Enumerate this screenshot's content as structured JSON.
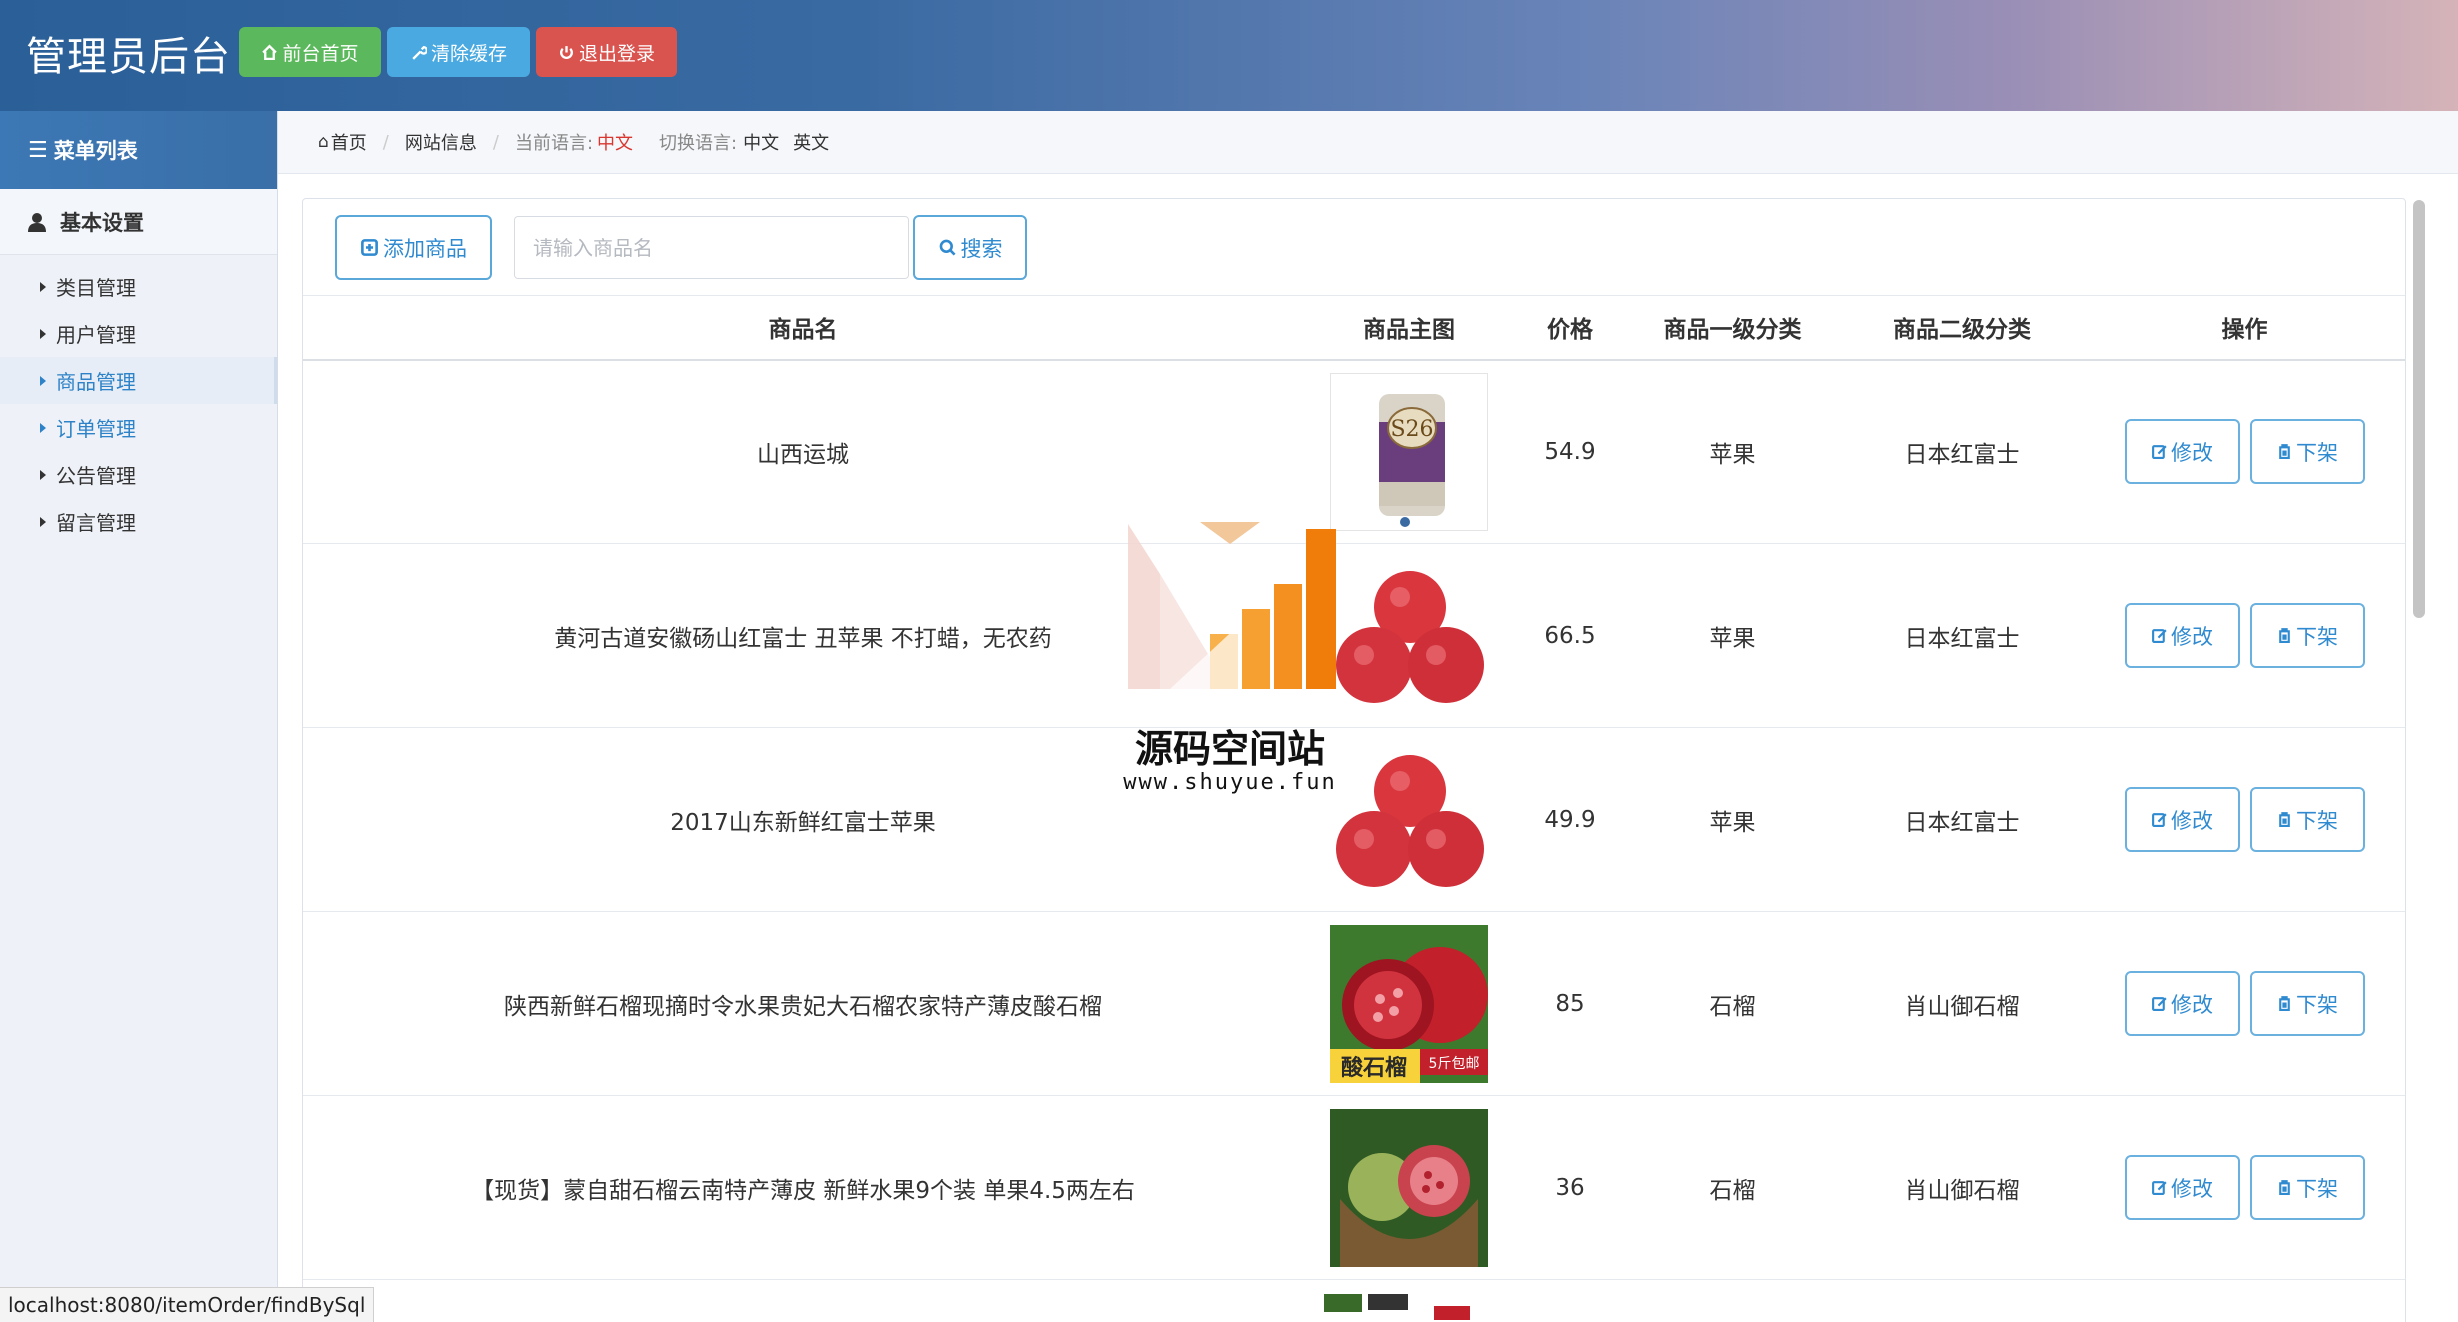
{
  "header": {
    "brand": "管理员后台",
    "buttons": [
      {
        "label": "前台首页",
        "icon": "home-icon",
        "color": "#5cb85c"
      },
      {
        "label": "清除缓存",
        "icon": "wrench-icon",
        "color": "#4aa9e0"
      },
      {
        "label": "退出登录",
        "icon": "power-icon",
        "color": "#d9534f"
      }
    ]
  },
  "sidebar": {
    "title": "菜单列表",
    "group": "基本设置",
    "items": [
      {
        "label": "类目管理",
        "active": false
      },
      {
        "label": "用户管理",
        "active": false
      },
      {
        "label": "商品管理",
        "active": true
      },
      {
        "label": "订单管理",
        "active": false
      },
      {
        "label": "公告管理",
        "active": false
      },
      {
        "label": "留言管理",
        "active": false
      }
    ]
  },
  "breadcrumb": {
    "home": "首页",
    "site_info": "网站信息",
    "current_lang_label": "当前语言:",
    "current_lang": "中文",
    "switch_label": "切换语言:",
    "lang_cn": "中文",
    "lang_en": "英文"
  },
  "toolbar": {
    "add_label": "添加商品",
    "search_placeholder": "请输入商品名",
    "search_label": "搜索"
  },
  "table": {
    "headers": [
      "商品名",
      "商品主图",
      "价格",
      "商品一级分类",
      "商品二级分类",
      "操作"
    ],
    "rows": [
      {
        "name": "山西运城",
        "image": "formula-can",
        "price": "54.9",
        "cat1": "苹果",
        "cat2": "日本红富士"
      },
      {
        "name": "黄河古道安徽砀山红富士 丑苹果 不打蜡，无农药",
        "image": "red-apples",
        "price": "66.5",
        "cat1": "苹果",
        "cat2": "日本红富士"
      },
      {
        "name": "2017山东新鲜红富士苹果",
        "image": "red-apples",
        "price": "49.9",
        "cat1": "苹果",
        "cat2": "日本红富士"
      },
      {
        "name": "陕西新鲜石榴现摘时令水果贵妃大石榴农家特产薄皮酸石榴",
        "image": "pomegranate-poster",
        "price": "85",
        "cat1": "石榴",
        "cat2": "肖山御石榴"
      },
      {
        "name": "【现货】蒙自甜石榴云南特产薄皮 新鲜水果9个装 单果4.5两左右",
        "image": "pomegranate-basket",
        "price": "36",
        "cat1": "石榴",
        "cat2": "肖山御石榴"
      }
    ],
    "edit_label": "修改",
    "offshelf_label": "下架",
    "image_texts": {
      "formula_can": "S26",
      "poster_main": "酸石榴",
      "poster_badge": "5斤包邮"
    }
  },
  "watermark": {
    "title": "源码空间站",
    "url": "www.shuyue.fun"
  },
  "statusbar": {
    "url": "localhost:8080/itemOrder/findBySql"
  }
}
